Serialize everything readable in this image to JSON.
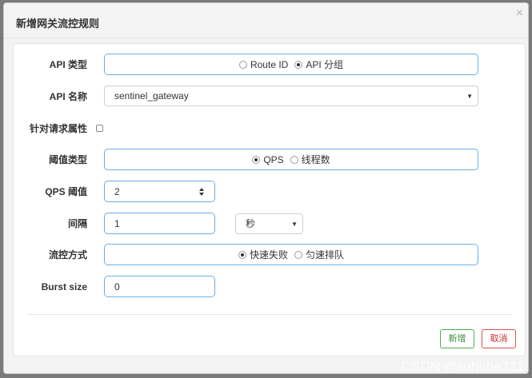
{
  "modal": {
    "title": "新增网关流控规则",
    "close": "×"
  },
  "form": {
    "api_type": {
      "label": "API 类型",
      "options": [
        "Route ID",
        "API 分组"
      ],
      "selected": "API 分组"
    },
    "api_name": {
      "label": "API 名称",
      "value": "sentinel_gateway"
    },
    "param_flow": {
      "label": "针对请求属性",
      "checked": false
    },
    "threshold_type": {
      "label": "阈值类型",
      "options": [
        "QPS",
        "线程数"
      ],
      "selected": "QPS"
    },
    "qps_threshold": {
      "label": "QPS 阈值",
      "value": "2"
    },
    "interval": {
      "label": "间隔",
      "value": "1",
      "unit": "秒"
    },
    "control_behavior": {
      "label": "流控方式",
      "options": [
        "快速失败",
        "匀速排队"
      ],
      "selected": "快速失败"
    },
    "burst": {
      "label": "Burst size",
      "value": "0"
    }
  },
  "actions": {
    "add": "新增",
    "cancel": "取消"
  },
  "watermark": "CSDN @liuhehe321"
}
